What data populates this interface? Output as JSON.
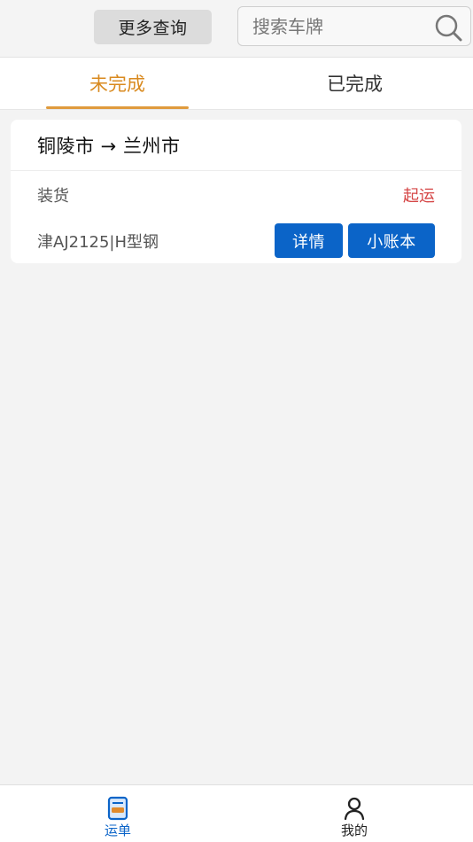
{
  "header": {
    "more_query_label": "更多查询",
    "search": {
      "placeholder": "搜索车牌",
      "value": "",
      "icon": "search-icon"
    }
  },
  "tabs": [
    {
      "label": "未完成",
      "active": true
    },
    {
      "label": "已完成",
      "active": false
    }
  ],
  "orders": [
    {
      "route": "铜陵市 → 兰州市",
      "stage": "装货",
      "status": "起运",
      "vehicle_cargo": "津AJ2125|H型钢",
      "actions": [
        "详情",
        "小账本"
      ]
    }
  ],
  "bottom_nav": [
    {
      "label": "运单",
      "icon": "document-icon",
      "active": true
    },
    {
      "label": "我的",
      "icon": "user-icon",
      "active": false
    }
  ],
  "colors": {
    "active_tab": "#d98a1f",
    "tab_indicator": "#e09b3d",
    "primary_button": "#0b64c8",
    "status_text": "#d54545",
    "nav_active": "#0b64c8"
  }
}
